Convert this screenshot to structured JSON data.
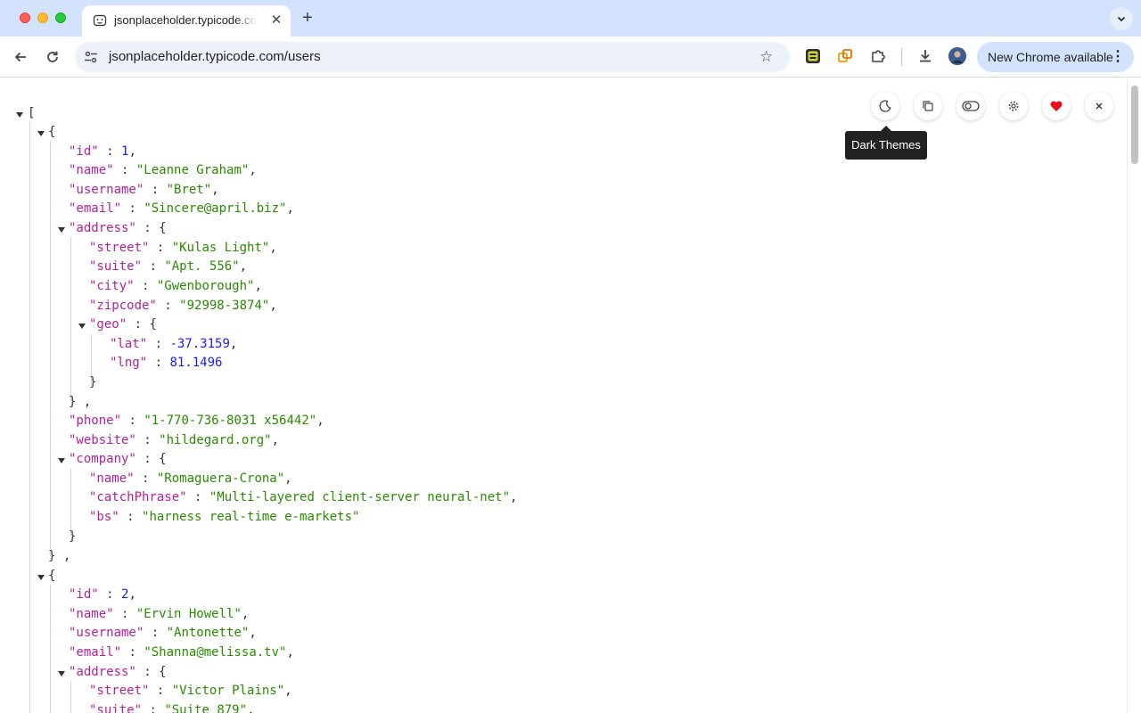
{
  "window": {
    "traffic_lights": [
      "close",
      "minimize",
      "zoom"
    ]
  },
  "tab": {
    "title": "jsonplaceholder.typicode.com",
    "favicon": "jsonplaceholder-favicon-icon",
    "close_icon": "close-icon"
  },
  "tabstrip": {
    "new_tab_icon": "plus-icon",
    "tab_search_icon": "chevron-down-icon"
  },
  "toolbar": {
    "back_icon": "arrow-left-icon",
    "reload_icon": "reload-icon",
    "url": "jsonplaceholder.typicode.com/users",
    "site_info_icon": "tune-icon",
    "bookmark_icon": "star-icon",
    "extensions": [
      "extension-app-icon",
      "extension-copy-icon",
      "puzzle-icon"
    ],
    "download_icon": "download-icon",
    "profile_icon": "avatar",
    "update_label": "New Chrome available",
    "menu_icon": "more-vert-icon"
  },
  "viewer_toolbar": {
    "buttons": [
      {
        "name": "dark-themes",
        "icon": "moon-icon"
      },
      {
        "name": "copy",
        "icon": "copy-icon"
      },
      {
        "name": "toggle-view",
        "icon": "toggle-icon"
      },
      {
        "name": "settings",
        "icon": "gear-icon"
      },
      {
        "name": "favorite",
        "icon": "heart-icon"
      },
      {
        "name": "close",
        "icon": "close-icon"
      }
    ],
    "tooltip": "Dark Themes"
  },
  "json": {
    "users": [
      {
        "id": "1",
        "name": "\"Leanne Graham\"",
        "username": "\"Bret\"",
        "email": "\"Sincere@april.biz\"",
        "address": {
          "street": "\"Kulas Light\"",
          "suite": "\"Apt. 556\"",
          "city": "\"Gwenborough\"",
          "zipcode": "\"92998-3874\"",
          "geo": {
            "lat": "-37.3159",
            "lng": "81.1496"
          }
        },
        "phone": "\"1-770-736-8031 x56442\"",
        "website": "\"hildegard.org\"",
        "company": {
          "name": "\"Romaguera-Crona\"",
          "catchPhrase": "\"Multi-layered client-server neural-net\"",
          "bs": "\"harness real-time e-markets\""
        }
      },
      {
        "id": "2",
        "name": "\"Ervin Howell\"",
        "username": "\"Antonette\"",
        "email": "\"Shanna@melissa.tv\"",
        "address": {
          "street": "\"Victor Plains\"",
          "suite": "\"Suite 879\""
        }
      }
    ]
  },
  "keys": {
    "id": "\"id\"",
    "name": "\"name\"",
    "username": "\"username\"",
    "email": "\"email\"",
    "address": "\"address\"",
    "street": "\"street\"",
    "suite": "\"suite\"",
    "city": "\"city\"",
    "zipcode": "\"zipcode\"",
    "geo": "\"geo\"",
    "lat": "\"lat\"",
    "lng": "\"lng\"",
    "phone": "\"phone\"",
    "website": "\"website\"",
    "company": "\"company\"",
    "catchPhrase": "\"catchPhrase\"",
    "bs": "\"bs\""
  }
}
